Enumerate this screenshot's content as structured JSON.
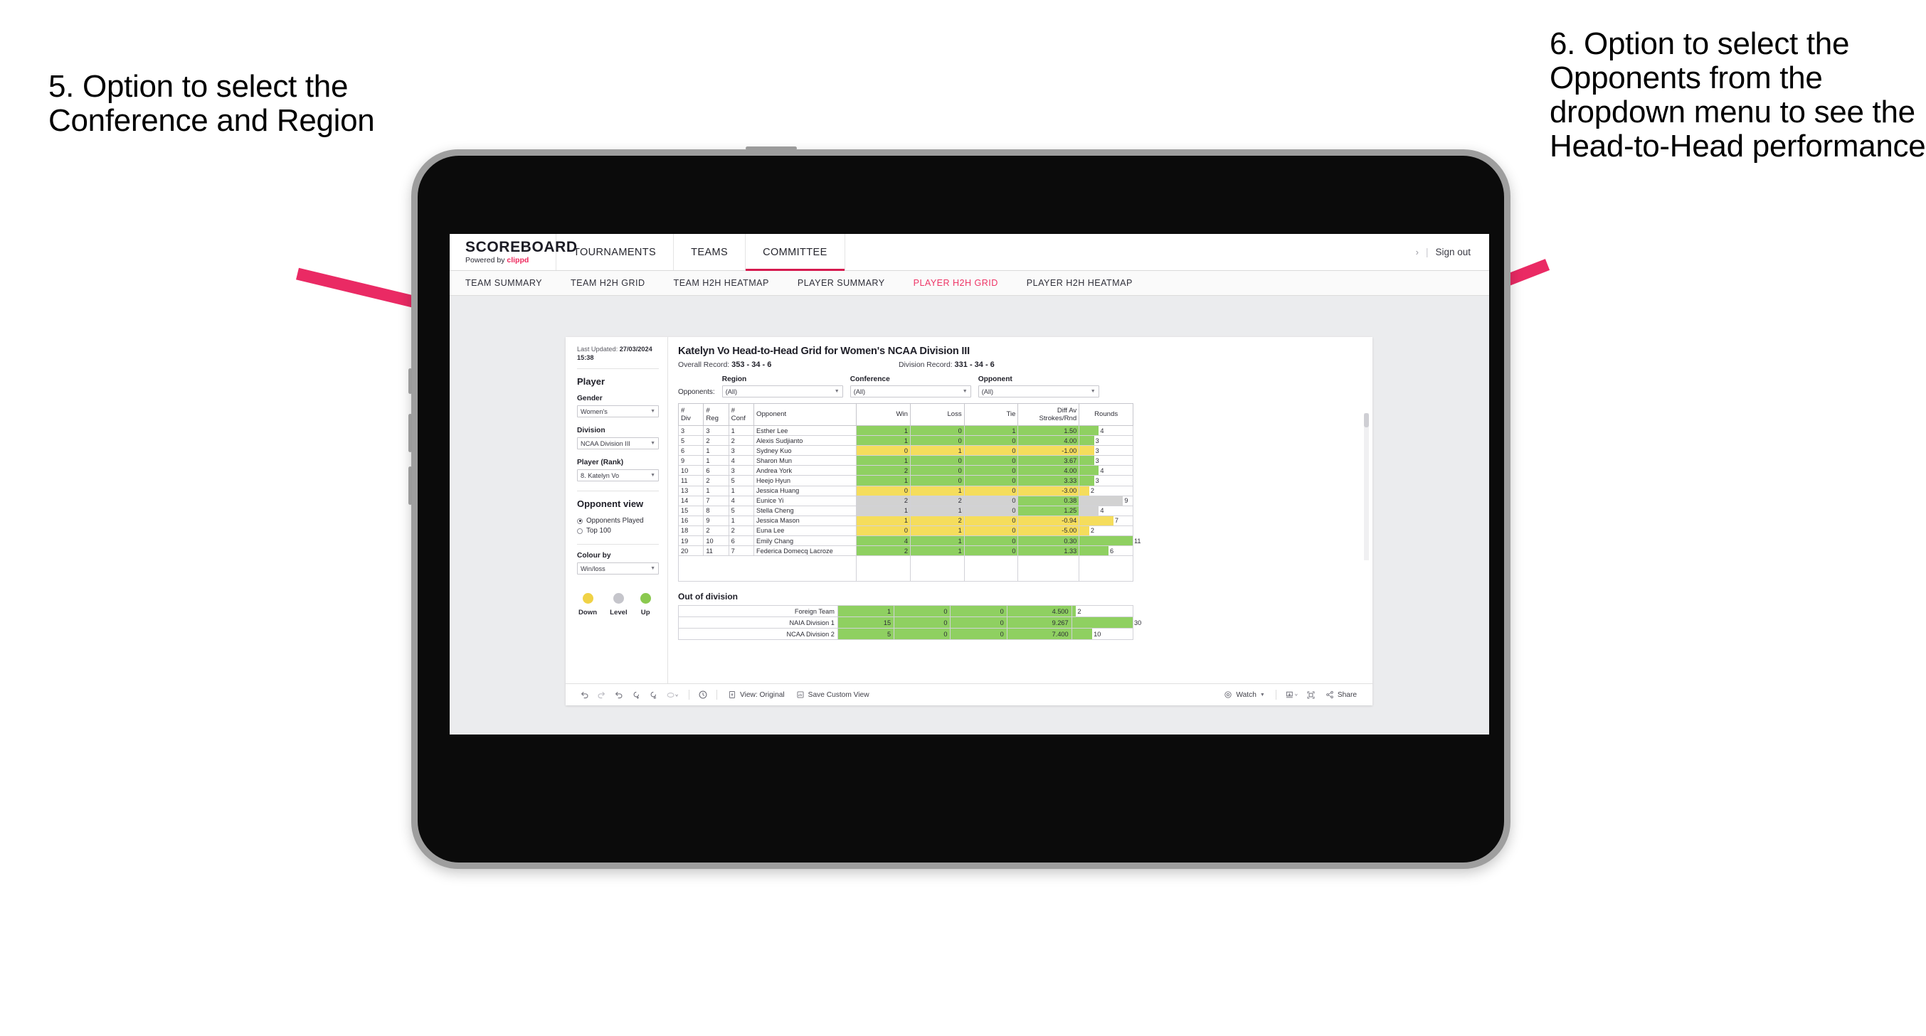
{
  "annotations": {
    "left": "5. Option to select the Conference and Region",
    "right": "6. Option to select the Opponents from the dropdown menu to see the Head-to-Head performance"
  },
  "app": {
    "brand": {
      "name": "SCOREBOARD",
      "powered_prefix": "Powered by ",
      "powered_brand": "clippd"
    },
    "topnav": [
      {
        "label": "TOURNAMENTS",
        "active": false
      },
      {
        "label": "TEAMS",
        "active": false
      },
      {
        "label": "COMMITTEE",
        "active": true
      }
    ],
    "account": {
      "chevron": "›",
      "divider": "|",
      "signout": "Sign out"
    },
    "subnav": [
      {
        "label": "TEAM SUMMARY",
        "active": false
      },
      {
        "label": "TEAM H2H GRID",
        "active": false
      },
      {
        "label": "TEAM H2H HEATMAP",
        "active": false
      },
      {
        "label": "PLAYER SUMMARY",
        "active": false
      },
      {
        "label": "PLAYER H2H GRID",
        "active": true
      },
      {
        "label": "PLAYER H2H HEATMAP",
        "active": false
      }
    ]
  },
  "sidebar": {
    "last_updated_label": "Last Updated: ",
    "last_updated_value": "27/03/2024",
    "last_updated_time": "15:38",
    "player_section_title": "Player",
    "gender": {
      "label": "Gender",
      "value": "Women's"
    },
    "division": {
      "label": "Division",
      "value": "NCAA Division III"
    },
    "player_rank": {
      "label": "Player (Rank)",
      "value": "8. Katelyn Vo"
    },
    "opponent_view": {
      "title": "Opponent view",
      "options": [
        {
          "label": "Opponents Played",
          "selected": true
        },
        {
          "label": "Top 100",
          "selected": false
        }
      ]
    },
    "colour_by": {
      "label": "Colour by",
      "value": "Win/loss"
    },
    "legend": [
      {
        "label": "Down",
        "color": "#f0d246"
      },
      {
        "label": "Level",
        "color": "#c5c5cb"
      },
      {
        "label": "Up",
        "color": "#8bc94f"
      }
    ]
  },
  "main": {
    "title": "Katelyn Vo Head-to-Head Grid for Women's NCAA Division III",
    "overall_record_label": "Overall Record: ",
    "overall_record_value": "353 - 34 - 6",
    "division_record_label": "Division Record: ",
    "division_record_value": "331 - 34 - 6",
    "opponents_label": "Opponents:",
    "filters": [
      {
        "label": "Region",
        "value": "(All)"
      },
      {
        "label": "Conference",
        "value": "(All)"
      },
      {
        "label": "Opponent",
        "value": "(All)"
      }
    ],
    "out_of_division_title": "Out of division"
  },
  "chart_data": {
    "type": "table",
    "title": "Katelyn Vo Head-to-Head Grid for Women's NCAA Division III",
    "columns": [
      "# Div",
      "# Reg",
      "# Conf",
      "Opponent",
      "Win",
      "Loss",
      "Tie",
      "Diff Av Strokes/Rnd",
      "Rounds"
    ],
    "column_headers_two_line": [
      [
        "#",
        "Div"
      ],
      [
        "#",
        "Reg"
      ],
      [
        "#",
        "Conf"
      ],
      [
        "Opponent",
        ""
      ],
      [
        "Win",
        ""
      ],
      [
        "Loss",
        ""
      ],
      [
        "Tie",
        ""
      ],
      [
        "Diff Av",
        "Strokes/Rnd"
      ],
      [
        "Rounds",
        ""
      ]
    ],
    "rounds_max": 11,
    "rows": [
      {
        "div": "3",
        "reg": "3",
        "conf": "1",
        "opponent": "Esther Lee",
        "win": "1",
        "loss": "0",
        "tie": "1",
        "diff": "1.50",
        "rounds": "4",
        "color": "green"
      },
      {
        "div": "5",
        "reg": "2",
        "conf": "2",
        "opponent": "Alexis Sudjianto",
        "win": "1",
        "loss": "0",
        "tie": "0",
        "diff": "4.00",
        "rounds": "3",
        "color": "green"
      },
      {
        "div": "6",
        "reg": "1",
        "conf": "3",
        "opponent": "Sydney Kuo",
        "win": "0",
        "loss": "1",
        "tie": "0",
        "diff": "-1.00",
        "rounds": "3",
        "color": "yellow"
      },
      {
        "div": "9",
        "reg": "1",
        "conf": "4",
        "opponent": "Sharon Mun",
        "win": "1",
        "loss": "0",
        "tie": "0",
        "diff": "3.67",
        "rounds": "3",
        "color": "green"
      },
      {
        "div": "10",
        "reg": "6",
        "conf": "3",
        "opponent": "Andrea York",
        "win": "2",
        "loss": "0",
        "tie": "0",
        "diff": "4.00",
        "rounds": "4",
        "color": "green"
      },
      {
        "div": "11",
        "reg": "2",
        "conf": "5",
        "opponent": "Heejo Hyun",
        "win": "1",
        "loss": "0",
        "tie": "0",
        "diff": "3.33",
        "rounds": "3",
        "color": "green"
      },
      {
        "div": "13",
        "reg": "1",
        "conf": "1",
        "opponent": "Jessica Huang",
        "win": "0",
        "loss": "1",
        "tie": "0",
        "diff": "-3.00",
        "rounds": "2",
        "color": "yellow"
      },
      {
        "div": "14",
        "reg": "7",
        "conf": "4",
        "opponent": "Eunice Yi",
        "win": "2",
        "loss": "2",
        "tie": "0",
        "diff": "0.38",
        "rounds": "9",
        "color": "grey",
        "diff_color": "green"
      },
      {
        "div": "15",
        "reg": "8",
        "conf": "5",
        "opponent": "Stella Cheng",
        "win": "1",
        "loss": "1",
        "tie": "0",
        "diff": "1.25",
        "rounds": "4",
        "color": "grey",
        "diff_color": "green"
      },
      {
        "div": "16",
        "reg": "9",
        "conf": "1",
        "opponent": "Jessica Mason",
        "win": "1",
        "loss": "2",
        "tie": "0",
        "diff": "-0.94",
        "rounds": "7",
        "color": "yellow"
      },
      {
        "div": "18",
        "reg": "2",
        "conf": "2",
        "opponent": "Euna Lee",
        "win": "0",
        "loss": "1",
        "tie": "0",
        "diff": "-5.00",
        "rounds": "2",
        "color": "yellow"
      },
      {
        "div": "19",
        "reg": "10",
        "conf": "6",
        "opponent": "Emily Chang",
        "win": "4",
        "loss": "1",
        "tie": "0",
        "diff": "0.30",
        "rounds": "11",
        "color": "green"
      },
      {
        "div": "20",
        "reg": "11",
        "conf": "7",
        "opponent": "Federica Domecq Lacroze",
        "win": "2",
        "loss": "1",
        "tie": "0",
        "diff": "1.33",
        "rounds": "6",
        "color": "green"
      }
    ],
    "out_of_division": {
      "rounds_max": 30,
      "rows": [
        {
          "name": "Foreign Team",
          "win": "1",
          "loss": "0",
          "tie": "0",
          "diff": "4.500",
          "rounds": "2",
          "color": "green"
        },
        {
          "name": "NAIA Division 1",
          "win": "15",
          "loss": "0",
          "tie": "0",
          "diff": "9.267",
          "rounds": "30",
          "color": "green"
        },
        {
          "name": "NCAA Division 2",
          "win": "5",
          "loss": "0",
          "tie": "0",
          "diff": "7.400",
          "rounds": "10",
          "color": "green"
        }
      ]
    },
    "colors": {
      "green": "#8fd061",
      "yellow": "#f5dd5c",
      "grey": "#d2d2d2",
      "accent": "#ee3566"
    }
  },
  "toolbar": {
    "icons": [
      "undo-icon",
      "redo-icon",
      "revert-icon",
      "refresh-data-icon",
      "pause-updates-icon",
      "shape-icon"
    ],
    "view_original": "View: Original",
    "save_custom_view": "Save Custom View",
    "watch": "Watch",
    "share": "Share"
  }
}
